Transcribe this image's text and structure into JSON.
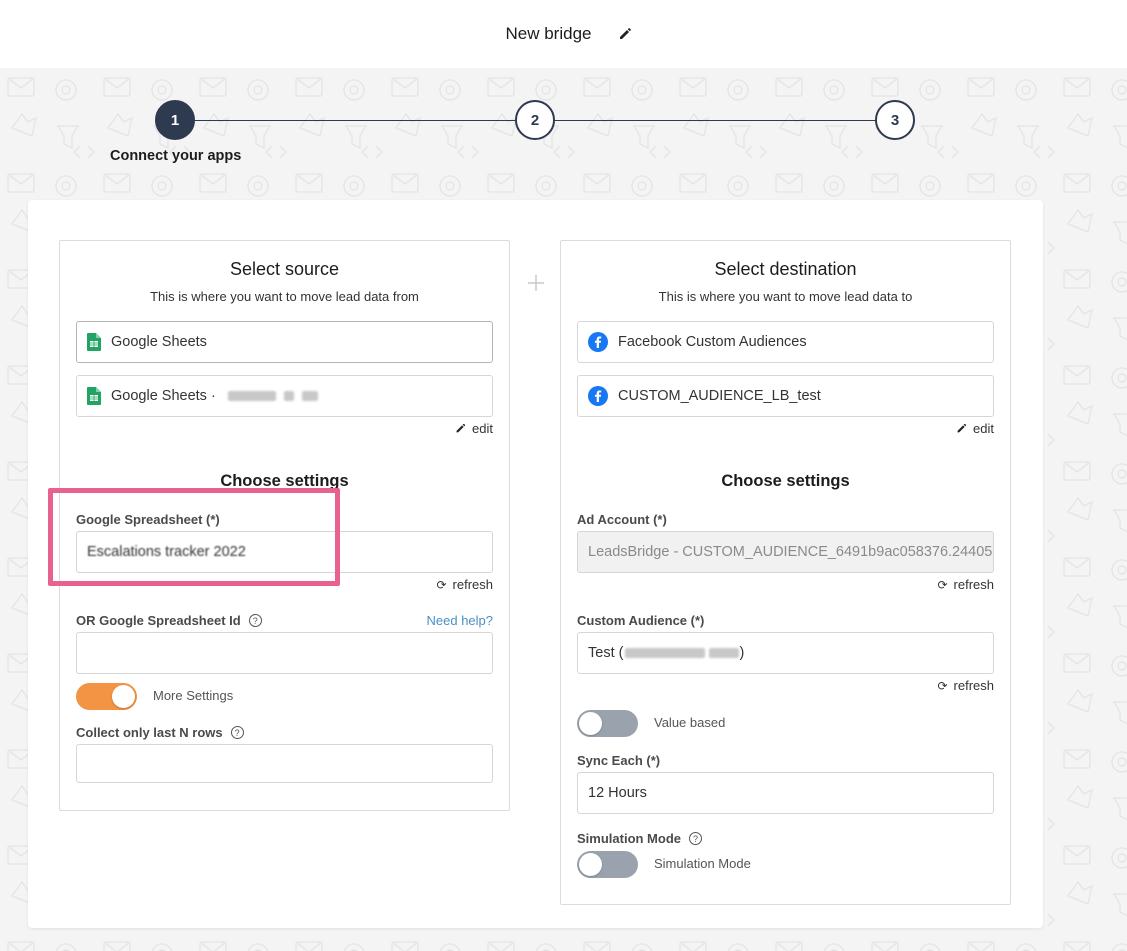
{
  "header": {
    "title": "New bridge"
  },
  "stepper": {
    "steps": [
      {
        "number": "1"
      },
      {
        "number": "2"
      },
      {
        "number": "3"
      }
    ],
    "active_label": "Connect your apps"
  },
  "source": {
    "title": "Select source",
    "subtitle": "This is where you want to move lead data from",
    "app_name": "Google Sheets",
    "account_name": "Google Sheets ·",
    "edit_label": "edit",
    "settings_title": "Choose settings",
    "spreadsheet_label": "Google Spreadsheet (*)",
    "spreadsheet_value": "Escalations tracker 2022",
    "refresh_label": "refresh",
    "spreadsheet_id_label": "OR Google Spreadsheet Id",
    "need_help_label": "Need help?",
    "spreadsheet_id_value": "",
    "more_settings_label": "More Settings",
    "more_settings_on": true,
    "last_rows_label": "Collect only last N rows",
    "last_rows_value": ""
  },
  "destination": {
    "title": "Select destination",
    "subtitle": "This is where you want to move lead data to",
    "app_name": "Facebook Custom Audiences",
    "account_name": "CUSTOM_AUDIENCE_LB_test",
    "edit_label": "edit",
    "settings_title": "Choose settings",
    "ad_account_label": "Ad Account (*)",
    "ad_account_value": "LeadsBridge - CUSTOM_AUDIENCE_6491b9ac058376.24405",
    "refresh_label": "refresh",
    "custom_audience_label": "Custom Audience (*)",
    "custom_audience_value": "Test (",
    "custom_audience_suffix": ")",
    "refresh_label_2": "refresh",
    "value_based_label": "Value based",
    "value_based_on": false,
    "sync_label": "Sync Each (*)",
    "sync_value": "12 Hours",
    "simulation_label": "Simulation Mode",
    "simulation_toggle_label": "Simulation Mode",
    "simulation_on": false
  },
  "colors": {
    "accent_orange": "#f29443",
    "stepper_navy": "#2e3a4f",
    "highlight_pink": "#e8628f",
    "link_blue": "#4a90c6",
    "sheets_green": "#1fa463",
    "facebook_blue": "#1877f2"
  }
}
